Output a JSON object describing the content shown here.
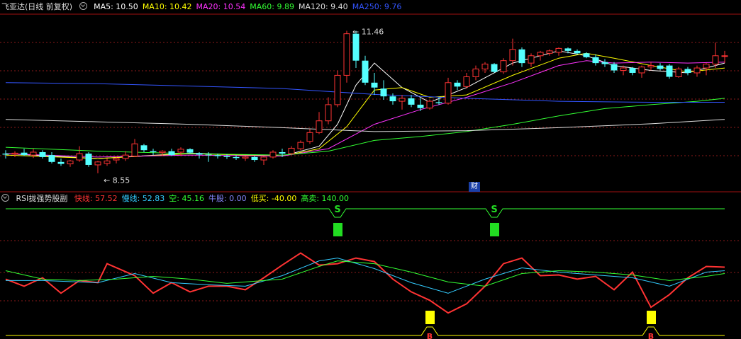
{
  "price_header": {
    "name": "飞亚达(日线 前复权)",
    "ma_items": [
      {
        "label": "MA5: 10.50",
        "color": "#ffffff"
      },
      {
        "label": "MA10: 10.42",
        "color": "#ffff00"
      },
      {
        "label": "MA20: 10.54",
        "color": "#ff33ff"
      },
      {
        "label": "MA60: 9.89",
        "color": "#33ff33"
      },
      {
        "label": "MA120: 9.40",
        "color": "#dddddd"
      },
      {
        "label": "MA250: 9.76",
        "color": "#3355ff"
      }
    ]
  },
  "rsi_header": {
    "name": "RSI拢强势股副",
    "items": [
      {
        "label": "快线: 57.52",
        "color": "#ff3333"
      },
      {
        "label": "慢线: 52.83",
        "color": "#33ccff"
      },
      {
        "label": "空: 45.16",
        "color": "#33ff33"
      },
      {
        "label": "牛股: 0.00",
        "color": "#8888ff"
      },
      {
        "label": "低买: -40.00",
        "color": "#ffff00"
      },
      {
        "label": "高卖: 140.00",
        "color": "#33ff33"
      }
    ]
  },
  "cai_badge": "财",
  "colors": {
    "up": "#ff3333",
    "down": "#55ffff",
    "grid": "#8b1a1a",
    "border": "#a01010"
  },
  "chart_data": [
    {
      "type": "candlestick",
      "ylim": [
        8.3,
        11.8
      ],
      "high_label": "11.46",
      "low_label": "8.55",
      "candles": [
        {
          "o": 8.95,
          "h": 9.02,
          "l": 8.85,
          "c": 8.93
        },
        {
          "o": 8.94,
          "h": 9.0,
          "l": 8.88,
          "c": 8.96
        },
        {
          "o": 8.97,
          "h": 9.05,
          "l": 8.9,
          "c": 8.92
        },
        {
          "o": 8.92,
          "h": 9.05,
          "l": 8.86,
          "c": 8.98
        },
        {
          "o": 8.98,
          "h": 9.02,
          "l": 8.85,
          "c": 8.88
        },
        {
          "o": 8.92,
          "h": 8.98,
          "l": 8.75,
          "c": 8.78
        },
        {
          "o": 8.78,
          "h": 8.85,
          "l": 8.7,
          "c": 8.74
        },
        {
          "o": 8.74,
          "h": 8.82,
          "l": 8.68,
          "c": 8.8
        },
        {
          "o": 8.82,
          "h": 9.1,
          "l": 8.78,
          "c": 8.95
        },
        {
          "o": 8.95,
          "h": 8.98,
          "l": 8.68,
          "c": 8.72
        },
        {
          "o": 8.72,
          "h": 8.8,
          "l": 8.55,
          "c": 8.78
        },
        {
          "o": 8.75,
          "h": 8.85,
          "l": 8.7,
          "c": 8.8
        },
        {
          "o": 8.82,
          "h": 8.9,
          "l": 8.75,
          "c": 8.85
        },
        {
          "o": 8.85,
          "h": 9.0,
          "l": 8.8,
          "c": 8.92
        },
        {
          "o": 8.9,
          "h": 9.25,
          "l": 8.88,
          "c": 9.15
        },
        {
          "o": 9.12,
          "h": 9.15,
          "l": 8.98,
          "c": 9.02
        },
        {
          "o": 9.0,
          "h": 9.05,
          "l": 8.92,
          "c": 8.98
        },
        {
          "o": 8.97,
          "h": 9.02,
          "l": 8.9,
          "c": 9.0
        },
        {
          "o": 9.0,
          "h": 9.05,
          "l": 8.9,
          "c": 8.92
        },
        {
          "o": 8.98,
          "h": 9.08,
          "l": 8.9,
          "c": 9.04
        },
        {
          "o": 9.04,
          "h": 9.06,
          "l": 8.95,
          "c": 8.97
        },
        {
          "o": 8.96,
          "h": 8.98,
          "l": 8.85,
          "c": 8.93
        },
        {
          "o": 8.93,
          "h": 8.98,
          "l": 8.78,
          "c": 8.92
        },
        {
          "o": 8.92,
          "h": 8.95,
          "l": 8.85,
          "c": 8.9
        },
        {
          "o": 8.9,
          "h": 8.94,
          "l": 8.84,
          "c": 8.88
        },
        {
          "o": 8.88,
          "h": 8.92,
          "l": 8.82,
          "c": 8.86
        },
        {
          "o": 8.86,
          "h": 8.9,
          "l": 8.8,
          "c": 8.88
        },
        {
          "o": 8.88,
          "h": 8.9,
          "l": 8.78,
          "c": 8.82
        },
        {
          "o": 8.82,
          "h": 8.9,
          "l": 8.72,
          "c": 8.88
        },
        {
          "o": 8.88,
          "h": 9.02,
          "l": 8.85,
          "c": 8.98
        },
        {
          "o": 8.98,
          "h": 9.05,
          "l": 8.88,
          "c": 8.95
        },
        {
          "o": 8.95,
          "h": 9.1,
          "l": 8.92,
          "c": 9.06
        },
        {
          "o": 9.05,
          "h": 9.22,
          "l": 9.02,
          "c": 9.18
        },
        {
          "o": 9.2,
          "h": 9.45,
          "l": 9.15,
          "c": 9.38
        },
        {
          "o": 9.38,
          "h": 9.8,
          "l": 9.35,
          "c": 9.62
        },
        {
          "o": 9.62,
          "h": 10.1,
          "l": 9.55,
          "c": 9.95
        },
        {
          "o": 9.95,
          "h": 10.65,
          "l": 9.9,
          "c": 10.55
        },
        {
          "o": 10.55,
          "h": 11.46,
          "l": 10.4,
          "c": 11.4
        },
        {
          "o": 11.4,
          "h": 11.46,
          "l": 10.7,
          "c": 10.85
        },
        {
          "o": 10.85,
          "h": 10.95,
          "l": 10.35,
          "c": 10.4
        },
        {
          "o": 10.4,
          "h": 10.6,
          "l": 10.15,
          "c": 10.3
        },
        {
          "o": 10.28,
          "h": 10.45,
          "l": 10.05,
          "c": 10.12
        },
        {
          "o": 10.12,
          "h": 10.18,
          "l": 9.95,
          "c": 10.02
        },
        {
          "o": 10.02,
          "h": 10.15,
          "l": 9.85,
          "c": 10.08
        },
        {
          "o": 10.08,
          "h": 10.15,
          "l": 9.9,
          "c": 9.95
        },
        {
          "o": 9.95,
          "h": 10.08,
          "l": 9.82,
          "c": 9.88
        },
        {
          "o": 9.88,
          "h": 10.05,
          "l": 9.85,
          "c": 10.02
        },
        {
          "o": 10.0,
          "h": 10.1,
          "l": 9.95,
          "c": 9.98
        },
        {
          "o": 9.98,
          "h": 10.5,
          "l": 9.95,
          "c": 10.4
        },
        {
          "o": 10.4,
          "h": 10.45,
          "l": 10.25,
          "c": 10.32
        },
        {
          "o": 10.32,
          "h": 10.6,
          "l": 10.28,
          "c": 10.52
        },
        {
          "o": 10.52,
          "h": 10.75,
          "l": 10.45,
          "c": 10.68
        },
        {
          "o": 10.68,
          "h": 10.82,
          "l": 10.6,
          "c": 10.78
        },
        {
          "o": 10.78,
          "h": 10.8,
          "l": 10.6,
          "c": 10.62
        },
        {
          "o": 10.62,
          "h": 10.9,
          "l": 10.58,
          "c": 10.85
        },
        {
          "o": 10.85,
          "h": 11.3,
          "l": 10.75,
          "c": 11.08
        },
        {
          "o": 11.08,
          "h": 11.12,
          "l": 10.72,
          "c": 10.8
        },
        {
          "o": 10.8,
          "h": 11.0,
          "l": 10.72,
          "c": 10.95
        },
        {
          "o": 10.95,
          "h": 11.05,
          "l": 10.85,
          "c": 11.02
        },
        {
          "o": 11.0,
          "h": 11.08,
          "l": 10.95,
          "c": 11.05
        },
        {
          "o": 11.02,
          "h": 11.12,
          "l": 10.95,
          "c": 11.1
        },
        {
          "o": 11.1,
          "h": 11.12,
          "l": 11.0,
          "c": 11.05
        },
        {
          "o": 11.05,
          "h": 11.08,
          "l": 10.98,
          "c": 11.0
        },
        {
          "o": 11.0,
          "h": 11.02,
          "l": 10.9,
          "c": 10.92
        },
        {
          "o": 10.92,
          "h": 10.98,
          "l": 10.75,
          "c": 10.8
        },
        {
          "o": 10.82,
          "h": 10.88,
          "l": 10.72,
          "c": 10.78
        },
        {
          "o": 10.78,
          "h": 10.82,
          "l": 10.6,
          "c": 10.65
        },
        {
          "o": 10.65,
          "h": 10.75,
          "l": 10.55,
          "c": 10.7
        },
        {
          "o": 10.7,
          "h": 10.72,
          "l": 10.55,
          "c": 10.6
        },
        {
          "o": 10.6,
          "h": 10.75,
          "l": 10.5,
          "c": 10.72
        },
        {
          "o": 10.72,
          "h": 10.82,
          "l": 10.65,
          "c": 10.75
        },
        {
          "o": 10.75,
          "h": 10.8,
          "l": 10.65,
          "c": 10.68
        },
        {
          "o": 10.75,
          "h": 10.78,
          "l": 10.48,
          "c": 10.52
        },
        {
          "o": 10.52,
          "h": 10.72,
          "l": 10.5,
          "c": 10.68
        },
        {
          "o": 10.68,
          "h": 10.72,
          "l": 10.55,
          "c": 10.6
        },
        {
          "o": 10.6,
          "h": 10.75,
          "l": 10.52,
          "c": 10.7
        },
        {
          "o": 10.7,
          "h": 10.8,
          "l": 10.55,
          "c": 10.78
        },
        {
          "o": 10.78,
          "h": 11.22,
          "l": 10.7,
          "c": 10.95
        },
        {
          "o": 10.95,
          "h": 11.05,
          "l": 10.8,
          "c": 10.95
        }
      ],
      "ma_series": [
        {
          "name": "MA5",
          "color": "#ffffff",
          "x": [
            0,
            10,
            20,
            30,
            34,
            36,
            38,
            40,
            43,
            46,
            50,
            55,
            60,
            63,
            66,
            70,
            74,
            78
          ],
          "y": [
            8.95,
            8.85,
            8.96,
            8.9,
            9.1,
            9.55,
            10.35,
            10.8,
            10.3,
            10.0,
            10.3,
            10.8,
            11.05,
            10.95,
            10.75,
            10.65,
            10.6,
            10.8
          ]
        },
        {
          "name": "MA10",
          "color": "#ffff00",
          "x": [
            0,
            10,
            20,
            30,
            34,
            37,
            40,
            43,
            46,
            50,
            55,
            60,
            63,
            66,
            70,
            74,
            78
          ],
          "y": [
            8.92,
            8.85,
            8.95,
            8.9,
            9.05,
            9.5,
            10.25,
            10.3,
            10.1,
            10.15,
            10.55,
            10.9,
            11.0,
            10.9,
            10.75,
            10.62,
            10.7
          ]
        },
        {
          "name": "MA20",
          "color": "#ff33ff",
          "x": [
            0,
            10,
            20,
            30,
            35,
            40,
            45,
            50,
            55,
            60,
            63,
            66,
            70,
            74,
            78
          ],
          "y": [
            8.95,
            8.88,
            8.92,
            8.9,
            9.05,
            9.55,
            9.85,
            10.1,
            10.4,
            10.75,
            10.85,
            10.8,
            10.82,
            10.8,
            10.82
          ]
        },
        {
          "name": "MA60",
          "color": "#33ff33",
          "x": [
            0,
            10,
            20,
            30,
            35,
            40,
            45,
            50,
            55,
            60,
            65,
            70,
            75,
            78
          ],
          "y": [
            9.08,
            9.0,
            8.95,
            8.92,
            9.0,
            9.22,
            9.3,
            9.4,
            9.55,
            9.72,
            9.87,
            9.95,
            10.02,
            10.08
          ]
        },
        {
          "name": "MA120",
          "color": "#dddddd",
          "x": [
            0,
            10,
            20,
            30,
            40,
            50,
            60,
            70,
            78
          ],
          "y": [
            9.65,
            9.6,
            9.55,
            9.48,
            9.4,
            9.42,
            9.48,
            9.56,
            9.65
          ]
        },
        {
          "name": "MA250",
          "color": "#3355ff",
          "x": [
            0,
            10,
            20,
            30,
            40,
            50,
            60,
            70,
            78
          ],
          "y": [
            10.4,
            10.38,
            10.33,
            10.28,
            10.16,
            10.08,
            10.02,
            10.0,
            10.0
          ]
        }
      ]
    },
    {
      "type": "line",
      "ylim": [
        -45,
        145
      ],
      "series": [
        {
          "name": "快线",
          "color": "#ff3333",
          "x": [
            0,
            2,
            4,
            6,
            8,
            10,
            11,
            14,
            16,
            18,
            20,
            22,
            24,
            26,
            28,
            30,
            32,
            34,
            36,
            38,
            40,
            42,
            44,
            46,
            48,
            50,
            52,
            54,
            56,
            58,
            60,
            62,
            64,
            66,
            68,
            70,
            72,
            74,
            76,
            78
          ],
          "y": [
            40,
            30,
            42,
            20,
            38,
            35,
            62,
            45,
            20,
            35,
            22,
            30,
            30,
            25,
            42,
            60,
            77,
            60,
            62,
            70,
            65,
            40,
            22,
            10,
            -8,
            5,
            30,
            62,
            70,
            45,
            46,
            40,
            44,
            25,
            50,
            0,
            18,
            42,
            58,
            57
          ]
        },
        {
          "name": "慢线",
          "color": "#33ccff",
          "x": [
            0,
            4,
            8,
            10,
            14,
            18,
            22,
            26,
            30,
            34,
            36,
            40,
            44,
            48,
            52,
            56,
            60,
            64,
            68,
            72,
            76,
            78
          ],
          "y": [
            38,
            38,
            36,
            35,
            48,
            35,
            32,
            30,
            45,
            66,
            70,
            55,
            35,
            20,
            40,
            56,
            50,
            46,
            42,
            30,
            50,
            52
          ]
        },
        {
          "name": "空",
          "color": "#33ff33",
          "x": [
            0,
            4,
            8,
            12,
            16,
            20,
            24,
            30,
            34,
            36,
            40,
            44,
            48,
            52,
            56,
            60,
            64,
            68,
            72,
            76,
            78
          ],
          "y": [
            52,
            40,
            38,
            40,
            44,
            40,
            34,
            40,
            58,
            66,
            62,
            50,
            36,
            30,
            48,
            52,
            50,
            46,
            38,
            44,
            48
          ]
        },
        {
          "name": "高卖",
          "color": "#33ff33",
          "x": [
            0,
            78
          ],
          "y": [
            140,
            140
          ]
        },
        {
          "name": "低买",
          "color": "#ffff00",
          "x": [
            0,
            78
          ],
          "y": [
            -40,
            -40
          ]
        }
      ],
      "signals": [
        {
          "type": "S",
          "x": 36,
          "y": 140,
          "color": "#22dd22"
        },
        {
          "type": "S",
          "x": 53,
          "y": 140,
          "color": "#22dd22"
        },
        {
          "type": "B",
          "x": 46,
          "y": -40,
          "color": "#ffff00"
        },
        {
          "type": "B",
          "x": 70,
          "y": -40,
          "color": "#ffff00"
        }
      ]
    }
  ]
}
